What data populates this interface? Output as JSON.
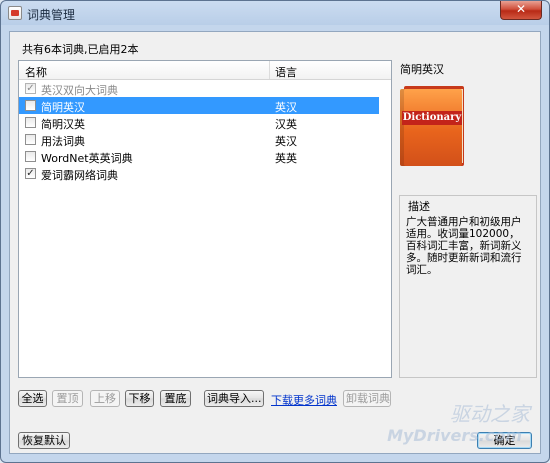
{
  "window": {
    "title": "词典管理",
    "close_glyph": "✕"
  },
  "summary": "共有6本词典,已启用2本",
  "list": {
    "headers": {
      "name": "名称",
      "language": "语言"
    },
    "rows": [
      {
        "name": "英汉双向大词典",
        "language": "",
        "checked": true,
        "disabled": true,
        "selected": false
      },
      {
        "name": "简明英汉",
        "language": "英汉",
        "checked": false,
        "disabled": false,
        "selected": true
      },
      {
        "name": "简明汉英",
        "language": "汉英",
        "checked": false,
        "disabled": false,
        "selected": false
      },
      {
        "name": "用法词典",
        "language": "英汉",
        "checked": false,
        "disabled": false,
        "selected": false
      },
      {
        "name": "WordNet英英词典",
        "language": "英英",
        "checked": false,
        "disabled": false,
        "selected": false
      },
      {
        "name": "爱词霸网络词典",
        "language": "",
        "checked": true,
        "disabled": false,
        "selected": false
      }
    ]
  },
  "detail": {
    "title": "简明英汉",
    "book_label": "Dictionary",
    "desc_label": "描述",
    "desc_text": "广大普通用户和初级用户适用。收词量102000，百科词汇丰富，新词新义多。随时更新新词和流行词汇。"
  },
  "buttons": {
    "select_all": "全选",
    "top": "置顶",
    "up": "上移",
    "down": "下移",
    "bottom": "置底",
    "import": "词典导入...",
    "download_more": "下载更多词典",
    "uninstall": "卸载词典",
    "restore": "恢复默认",
    "ok": "确定"
  },
  "watermark": {
    "line1": "驱动之家",
    "line2": "MyDrivers.com"
  },
  "colors": {
    "selection": "#3399ff",
    "link": "#0033cc",
    "book": "#e8641c"
  }
}
